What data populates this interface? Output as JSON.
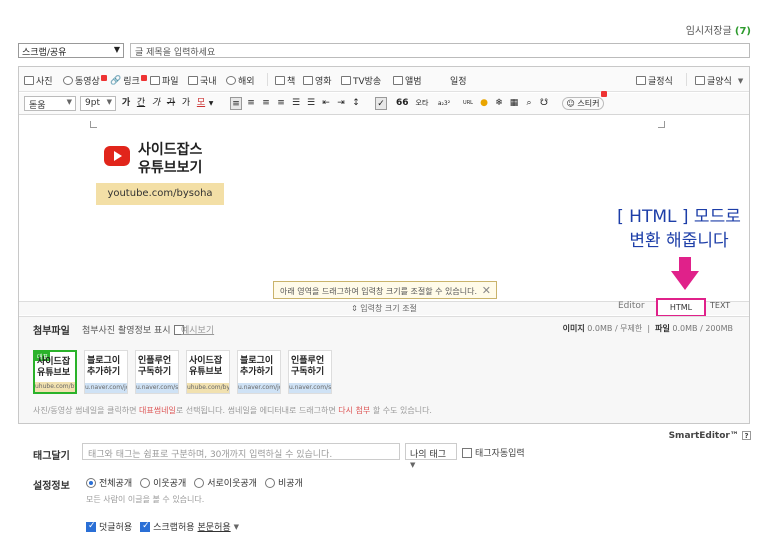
{
  "draft": {
    "label": "임시저장글",
    "count": "(7)"
  },
  "category": {
    "value": "스크랩/공유"
  },
  "title_input": {
    "placeholder": "글 제목을 입력하세요"
  },
  "toolbar1": {
    "photo": "사진",
    "video": "동영상",
    "link": "링크",
    "file": "파일",
    "domestic": "국내",
    "overseas": "해외",
    "book": "책",
    "movie": "영화",
    "tv": "TV방송",
    "album": "앨범",
    "schedule": "일정",
    "style": "글정식",
    "template": "글양식"
  },
  "toolbar2": {
    "font": "돋움",
    "size": "9pt",
    "bold": "가",
    "underline": "간",
    "italic": "가",
    "strike": "가",
    "super": "가",
    "color": "모",
    "quote": "66",
    "translate": "오타",
    "char": "a₂3²",
    "url": "URL",
    "sticker": "스티커"
  },
  "logo": {
    "line1": "사이드잡스",
    "line2": "유튜브보기",
    "url": "youtube.com/bysoha"
  },
  "annotation": {
    "line1": "[ HTML ] 모드로",
    "line2": "변환 해줍니다"
  },
  "resize_tip": "아래 영역을 드래그하여 입력창 크기를 조절할 수 있습니다.",
  "resize_bar": "⇕ 입력창 크기 조절",
  "modes": {
    "editor": "Editor",
    "html": "HTML",
    "text": "TEXT"
  },
  "attach": {
    "title": "첨부파일",
    "show_photo": "첨부사진 촬영정보 표시",
    "preview": "예시보기",
    "image_label": "이미지",
    "image_size": "0.0MB",
    "image_limit": "/ 무제한",
    "file_label": "파일",
    "file_size": "0.0MB",
    "file_limit": "/ 200MB",
    "thumbnails": [
      {
        "tag": "대표",
        "l1": "사이드잡",
        "l2": "유튜브보",
        "bottom": "uhube.com/bysc",
        "style": "gold"
      },
      {
        "tag": "",
        "l1": "블로그이",
        "l2": "추가하기",
        "bottom": "u.naver.com/joolse",
        "style": "blue"
      },
      {
        "tag": "",
        "l1": "인플루언",
        "l2": "구독하기",
        "bottom": "u.naver.com/sch",
        "style": "blue"
      },
      {
        "tag": "",
        "l1": "사이드잡",
        "l2": "유튜브보",
        "bottom": "uhube.com/bysc",
        "style": "gold"
      },
      {
        "tag": "",
        "l1": "블로그이",
        "l2": "추가하기",
        "bottom": "u.naver.com/joolse",
        "style": "blue"
      },
      {
        "tag": "",
        "l1": "인플루언",
        "l2": "구독하기",
        "bottom": "u.naver.com/sch",
        "style": "blue"
      }
    ],
    "desc_prefix": "사진/동영상 썸네일을 클릭하면",
    "desc_highlight1": "대표썸네일",
    "desc_mid": "로 선택됩니다. 썸네일을 에디터내로 드래그하면",
    "desc_highlight2": "다시 첨부",
    "desc_suffix": "할 수도 있습니다."
  },
  "smarteditor": "SmartEditor™",
  "tags": {
    "label": "태그달기",
    "placeholder": "태그와 태그는 쉼표로 구분하며, 30개까지 입력하실 수 있습니다.",
    "my_tag": "나의 태그",
    "auto": "태그자동입력"
  },
  "settings": {
    "label": "설정정보",
    "visibility": [
      "전체공개",
      "이웃공개",
      "서로이웃공개",
      "비공개"
    ],
    "visibility_desc": "모든 사람이 이글을 볼 수 있습니다.",
    "comment": "덧글허용",
    "scrap": "스크랩허용",
    "scrap_scope": "본문허용"
  },
  "colors": {
    "accent": "#2ab22a",
    "highlight": "#e0218a",
    "annotation": "#1d3ea8"
  }
}
